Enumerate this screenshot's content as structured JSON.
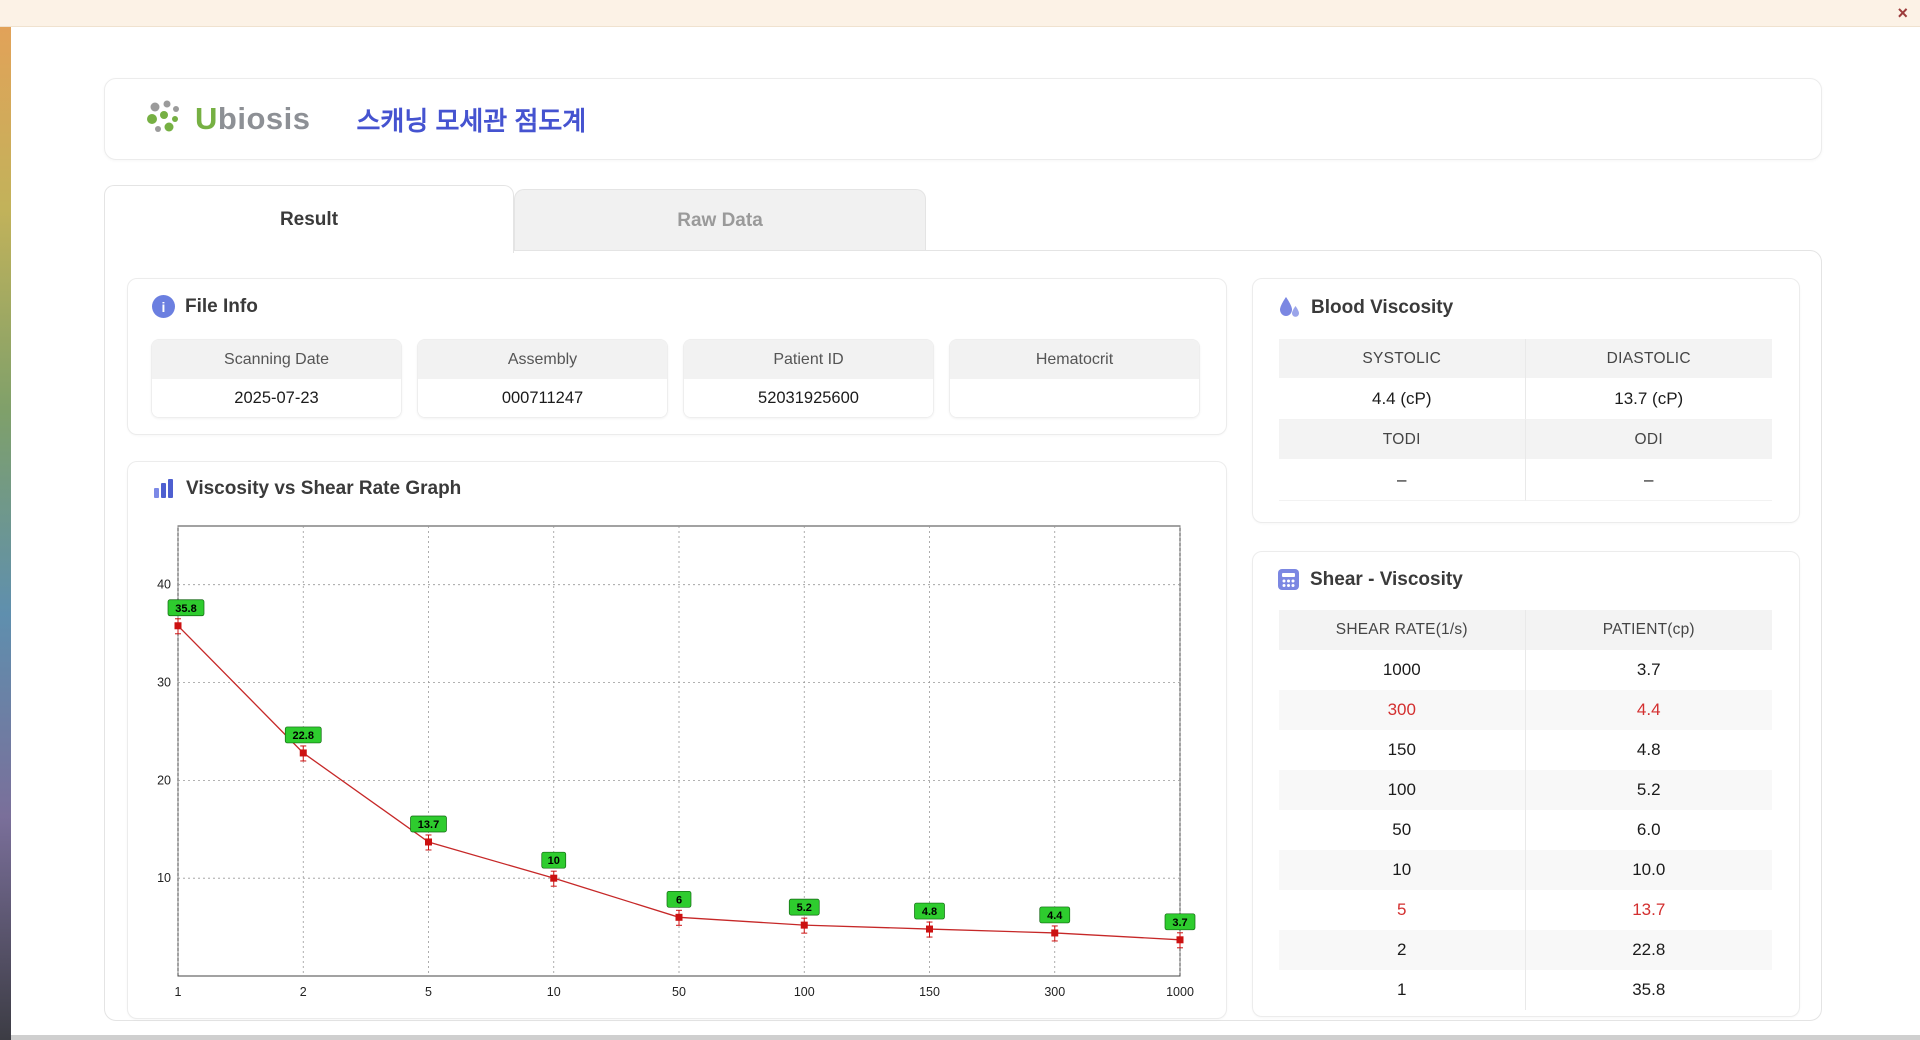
{
  "window": {
    "close_label": "×"
  },
  "header": {
    "logo_text": "Ubiosis",
    "title": "스캐닝 모세관 점도계"
  },
  "tabs": [
    {
      "label": "Result",
      "active": true
    },
    {
      "label": "Raw Data",
      "active": false
    }
  ],
  "file_info": {
    "title": "File Info",
    "fields": [
      {
        "label": "Scanning Date",
        "value": "2025-07-23"
      },
      {
        "label": "Assembly",
        "value": "000711247"
      },
      {
        "label": "Patient ID",
        "value": "52031925600"
      },
      {
        "label": "Hematocrit",
        "value": ""
      }
    ]
  },
  "blood_viscosity": {
    "title": "Blood Viscosity",
    "rows": [
      {
        "headers": [
          "SYSTOLIC",
          "DIASTOLIC"
        ],
        "values": [
          "4.4 (cP)",
          "13.7 (cP)"
        ]
      },
      {
        "headers": [
          "TODI",
          "ODI"
        ],
        "values": [
          "–",
          "–"
        ]
      }
    ]
  },
  "shear_table": {
    "title": "Shear - Viscosity",
    "columns": [
      "SHEAR RATE(1/s)",
      "PATIENT(cp)"
    ],
    "rows": [
      {
        "shear": "1000",
        "patient": "3.7",
        "highlight": false
      },
      {
        "shear": "300",
        "patient": "4.4",
        "highlight": true
      },
      {
        "shear": "150",
        "patient": "4.8",
        "highlight": false
      },
      {
        "shear": "100",
        "patient": "5.2",
        "highlight": false
      },
      {
        "shear": "50",
        "patient": "6.0",
        "highlight": false
      },
      {
        "shear": "10",
        "patient": "10.0",
        "highlight": false
      },
      {
        "shear": "5",
        "patient": "13.7",
        "highlight": true
      },
      {
        "shear": "2",
        "patient": "22.8",
        "highlight": false
      },
      {
        "shear": "1",
        "patient": "35.8",
        "highlight": false
      }
    ]
  },
  "chart_data": {
    "type": "line",
    "title": "Viscosity vs Shear Rate Graph",
    "categories": [
      1,
      2,
      5,
      10,
      50,
      100,
      150,
      300,
      1000
    ],
    "values": [
      35.8,
      22.8,
      13.7,
      10,
      6,
      5.2,
      4.8,
      4.4,
      3.7
    ],
    "labels": [
      "35.8",
      "22.8",
      "13.7",
      "10",
      "6",
      "5.2",
      "4.8",
      "4.4",
      "3.7"
    ],
    "y_ticks": [
      10,
      20,
      30,
      40
    ],
    "ylim": [
      0,
      46
    ],
    "xlabel": "",
    "ylabel": "",
    "grid": "dashed",
    "legend": "none",
    "line_color": "#c62828",
    "marker_color": "#cc1111",
    "label_bg": "#2ecc2e",
    "label_border": "#116611"
  }
}
